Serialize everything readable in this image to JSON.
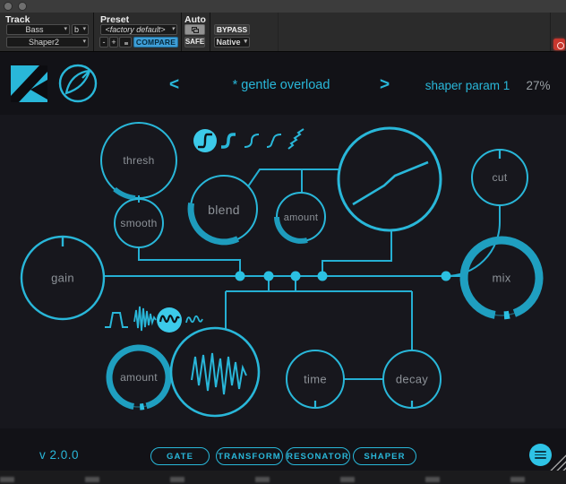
{
  "colors": {
    "accent": "#29b7d9",
    "accent_bright": "#3ccae9",
    "arc": "#1e9cbd",
    "label": "#8d9298",
    "compare_bg": "#3f9ed6",
    "record_red": "#c8372e"
  },
  "daw_header": {
    "track": {
      "label": "Track",
      "name_value": "Bass",
      "letter_value": "b",
      "plugin_value": "Shaper2"
    },
    "preset": {
      "label": "Preset",
      "value": "<factory default>",
      "minus": "-",
      "plus": "+",
      "compare": "COMPARE"
    },
    "auto": {
      "label": "Auto",
      "safe": "SAFE"
    },
    "bypass": {
      "label": "BYPASS"
    },
    "format": {
      "value": "Native"
    }
  },
  "plugin_header": {
    "prev": "<",
    "next": ">",
    "preset_name": "* gentle overload",
    "param_name": "shaper param 1",
    "param_value": "27%"
  },
  "shape_selector": {
    "selected_index": 0,
    "icons": [
      "step-curve",
      "thick-s-curve",
      "smooth-s-curve",
      "kinked-s-curve",
      "jagged-curve"
    ]
  },
  "wave_selector": {
    "selected_index": 2,
    "icons": [
      "trapezoid-wave",
      "burst-wave",
      "squiggle-wave",
      "noisy-sine-wave"
    ]
  },
  "knobs": [
    {
      "id": "thresh",
      "label": "thresh"
    },
    {
      "id": "smooth",
      "label": "smooth"
    },
    {
      "id": "blend",
      "label": "blend"
    },
    {
      "id": "amount-top",
      "label": "amount"
    },
    {
      "id": "gain",
      "label": "gain"
    },
    {
      "id": "cut",
      "label": "cut"
    },
    {
      "id": "mix",
      "label": "mix"
    },
    {
      "id": "amount-bottom",
      "label": "amount"
    },
    {
      "id": "time",
      "label": "time"
    },
    {
      "id": "decay",
      "label": "decay"
    }
  ],
  "bottom_bar": {
    "version": "v 2.0.0",
    "tabs": [
      {
        "label": "GATE"
      },
      {
        "label": "TRANSFORM"
      },
      {
        "label": "RESONATOR"
      },
      {
        "label": "SHAPER"
      }
    ]
  }
}
